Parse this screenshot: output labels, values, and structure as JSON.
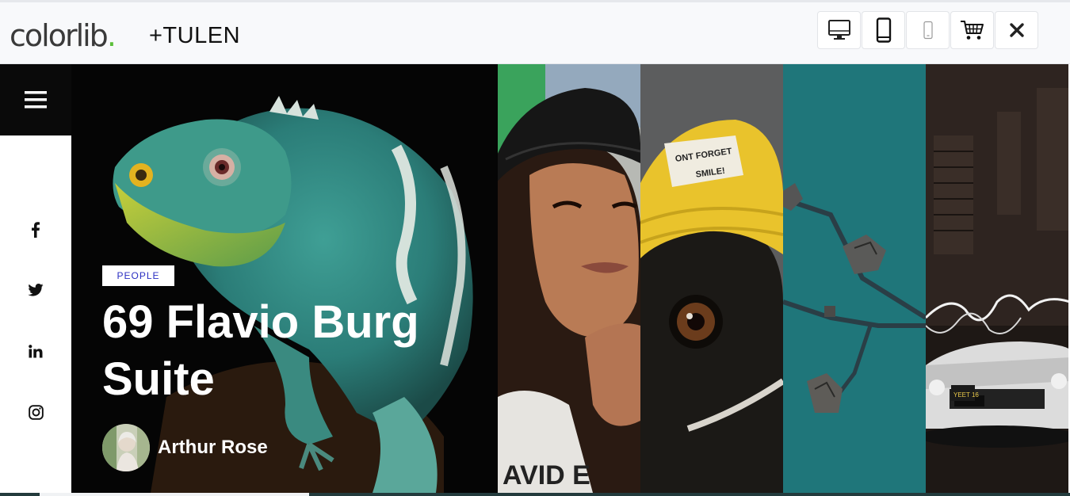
{
  "topbar": {
    "logo_text": "colorlib",
    "logo_dot": ".",
    "theme_name": "+TULEN",
    "buttons": [
      {
        "name": "desktop-view-button",
        "icon": "desktop-icon"
      },
      {
        "name": "tablet-view-button",
        "icon": "tablet-icon"
      },
      {
        "name": "mobile-view-button",
        "icon": "mobile-icon"
      },
      {
        "name": "buy-button",
        "icon": "cart-icon"
      },
      {
        "name": "close-button",
        "icon": "close-icon"
      }
    ]
  },
  "sidebar": {
    "menu_icon": "hamburger-icon",
    "social": [
      "facebook-icon",
      "twitter-icon",
      "linkedin-icon",
      "instagram-icon"
    ]
  },
  "hero": {
    "category": "PEOPLE",
    "title_line1": "69 Flavio Burg",
    "title_line2": "Suite",
    "author": "Arthur Rose"
  },
  "colors": {
    "accent_tag_text": "#2b2fc2",
    "logo_dot": "#5bbf3a",
    "sidebar_menu_bg": "#0a0a0a"
  }
}
